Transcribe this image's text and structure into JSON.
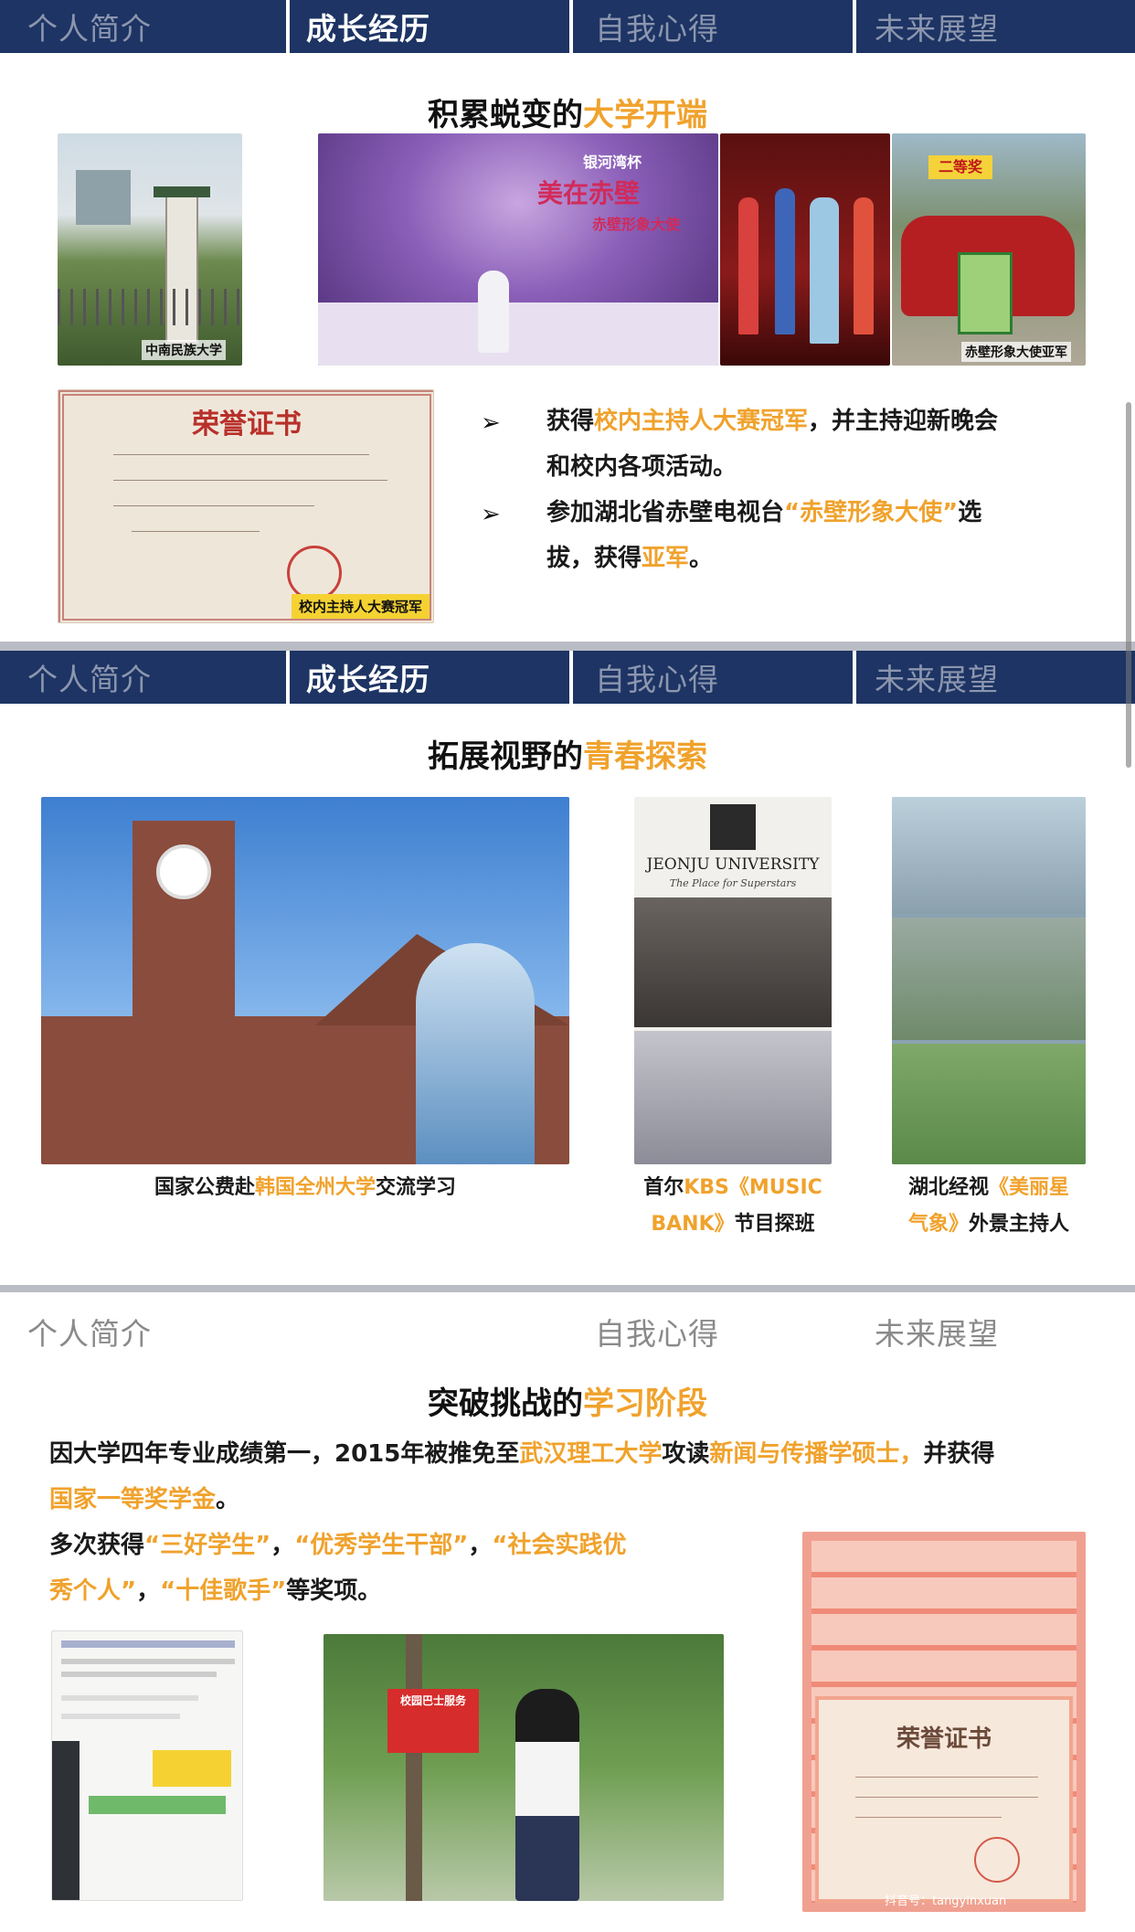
{
  "nav": {
    "tab1": "个人简介",
    "tab2": "成长经历",
    "tab3": "自我心得",
    "tab4": "未来展望"
  },
  "section1": {
    "title_a": "积累蜕变的",
    "title_b": "大学开端",
    "photo_campus_caption": "中南民族大学",
    "photo_stage_banner_a": "美在赤壁",
    "photo_stage_banner_b": "赤壁形象大使",
    "photo_stage_logo": "银河湾杯",
    "photo_car_caption": "赤壁形象大使亚军",
    "photo_car_badge": "二等奖",
    "cert_title": "荣誉证书",
    "cert_caption": "校内主持人大赛冠军",
    "bullet1_a": "获得",
    "bullet1_b": "校内主持人大赛冠军",
    "bullet1_c": "，并主持迎新晚会",
    "bullet1_d": "和校内各项活动。",
    "bullet2_a": "参加湖北省赤壁电视台",
    "bullet2_b": "“赤壁形象大使”",
    "bullet2_c": "选",
    "bullet2_d": "拔，获得",
    "bullet2_e": "亚军",
    "bullet2_f": "。"
  },
  "section2": {
    "title_a": "拓展视野的",
    "title_b": "青春探索",
    "jeonju_name": "JEONJU UNIVERSITY",
    "jeonju_motto": "The Place for Superstars",
    "cap1_a": "国家公费赴",
    "cap1_b": "韩国全州大学",
    "cap1_c": "交流学习",
    "cap2_a": "首尔",
    "cap2_b": "KBS《MUSIC",
    "cap2_c": "BANK》",
    "cap2_d": "节目探班",
    "cap3_a": "湖北经视",
    "cap3_b": "《美丽星",
    "cap3_c": "气象》",
    "cap3_d": "外景主持人"
  },
  "section3": {
    "title_a": "突破挑战的",
    "title_b": "学习阶段",
    "p1_a": "因大学四年专业成绩第一，2015年被推免至",
    "p1_b": "武汉理工大学",
    "p1_c": "攻读",
    "p1_d": "新闻与传播学硕士，",
    "p1_e": "并获得",
    "p1_f": "国家一等奖学金",
    "p1_g": "。",
    "p2_a": "多次获得",
    "p2_b": "“三好学生”",
    "p2_c": "，",
    "p2_d": "“优秀学生干部”",
    "p2_e": "，",
    "p2_f": "“社会实践优",
    "p2_g": "秀个人”",
    "p2_h": "，",
    "p2_i": "“十佳歌手”",
    "p2_j": "等奖项。",
    "cert_title": "荣誉证书",
    "sign_text": "校园巴士服务",
    "watermark": "抖音号：tangyinxuan"
  },
  "colors": {
    "navy": "#1d3464",
    "accent": "#f0a22c"
  }
}
